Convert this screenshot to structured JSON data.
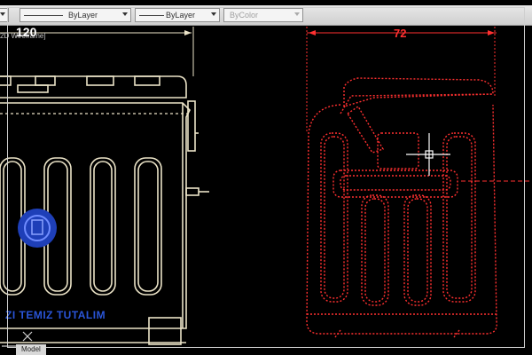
{
  "toolbar": {
    "linetype": "ByLayer",
    "lineweight": "ByLayer",
    "plotstyle": "ByColor"
  },
  "drawing": {
    "view_label": "2D Wireframe]",
    "dim_left": "120",
    "dim_right": "72",
    "brand_text": "ZI TEMIZ TUTALIM"
  },
  "layout_tabs": {
    "model": "Model"
  },
  "colors": {
    "background": "#000000",
    "left_geometry": "#ece4c8",
    "right_geometry": "#ff3030",
    "brand_blue": "#2a55d8",
    "crosshair": "#ffffff"
  },
  "icons": [
    "dropdown-arrow-icon",
    "ucs-icon",
    "crosshair-icon",
    "logo-emblem-icon"
  ]
}
